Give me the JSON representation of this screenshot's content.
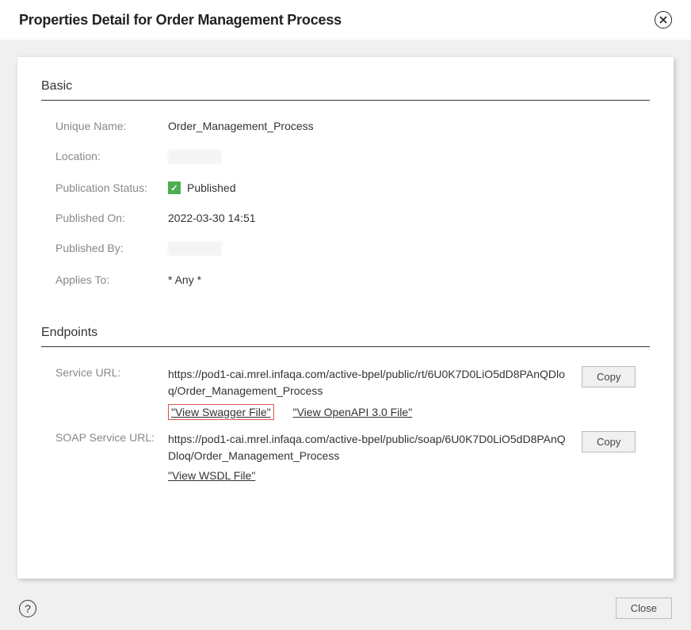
{
  "title": "Properties Detail for Order Management Process",
  "basic": {
    "heading": "Basic",
    "uniqueNameLabel": "Unique Name:",
    "uniqueNameValue": "Order_Management_Process",
    "locationLabel": "Location:",
    "publicationStatusLabel": "Publication Status:",
    "publicationStatusValue": "Published",
    "publishedOnLabel": "Published On:",
    "publishedOnValue": "2022-03-30 14:51",
    "publishedByLabel": "Published By:",
    "appliesToLabel": "Applies To:",
    "appliesToValue": "* Any *"
  },
  "endpoints": {
    "heading": "Endpoints",
    "serviceUrlLabel": "Service URL:",
    "serviceUrlValue": "https://pod1-cai.mrel.infaqa.com/active-bpel/public/rt/6U0K7D0LiO5dD8PAnQDloq/Order_Management_Process",
    "viewSwaggerLabel": "\"View Swagger File\"",
    "viewOpenApiLabel": "\"View OpenAPI 3.0 File\"",
    "soapServiceUrlLabel": "SOAP Service URL:",
    "soapServiceUrlValue": "https://pod1-cai.mrel.infaqa.com/active-bpel/public/soap/6U0K7D0LiO5dD8PAnQDloq/Order_Management_Process",
    "viewWsdlLabel": "\"View WSDL File\"",
    "copyLabel": "Copy"
  },
  "footer": {
    "closeLabel": "Close"
  }
}
